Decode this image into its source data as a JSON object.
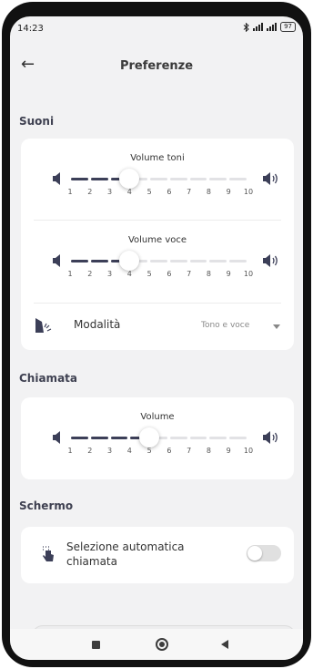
{
  "status": {
    "time": "14:23",
    "battery": "97"
  },
  "appbar": {
    "title": "Preferenze",
    "back_icon": "arrow-left-icon"
  },
  "colors": {
    "accent": "#3c3f58",
    "track_inactive": "#e2e2e5",
    "toggle_off": "#e0e0e0"
  },
  "sounds": {
    "header": "Suoni",
    "tone_volume": {
      "label": "Volume toni",
      "value": 4,
      "min": 1,
      "max": 10,
      "ticks": [
        "1",
        "2",
        "3",
        "4",
        "5",
        "6",
        "7",
        "8",
        "9",
        "10"
      ]
    },
    "voice_volume": {
      "label": "Volume voce",
      "value": 4,
      "min": 1,
      "max": 10,
      "ticks": [
        "1",
        "2",
        "3",
        "4",
        "5",
        "6",
        "7",
        "8",
        "9",
        "10"
      ]
    },
    "mode": {
      "label": "Modalità",
      "value": "Tono e voce"
    }
  },
  "call": {
    "header": "Chiamata",
    "volume": {
      "label": "Volume",
      "value": 5,
      "min": 1,
      "max": 10,
      "ticks": [
        "1",
        "2",
        "3",
        "4",
        "5",
        "6",
        "7",
        "8",
        "9",
        "10"
      ]
    }
  },
  "screen": {
    "header": "Schermo",
    "auto_select": {
      "label": "Selezione automatica chiamata",
      "enabled": false
    }
  }
}
